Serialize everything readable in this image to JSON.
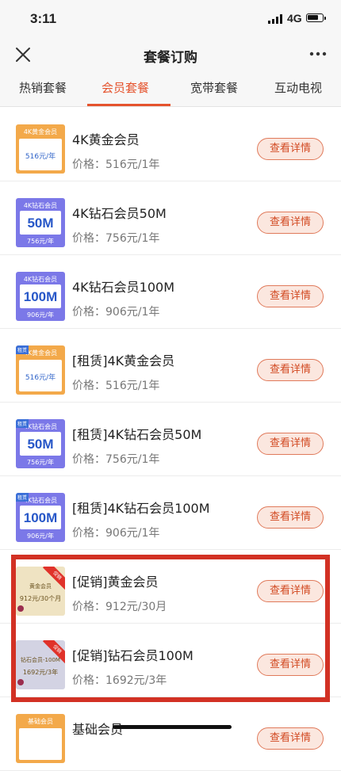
{
  "status": {
    "time": "3:11",
    "network": "4G"
  },
  "nav": {
    "title": "套餐订购"
  },
  "tabs": [
    {
      "label": "热销套餐"
    },
    {
      "label": "会员套餐"
    },
    {
      "label": "宽带套餐"
    },
    {
      "label": "互动电视"
    }
  ],
  "items": [
    {
      "title": "4K黄金会员",
      "price": "价格：516元/1年",
      "button": "查看详情",
      "thumb": {
        "caption": "4K黄金会员",
        "price": "516元/年"
      }
    },
    {
      "title": "4K钻石会员50M",
      "price": "价格：756元/1年",
      "button": "查看详情",
      "thumb": {
        "caption": "4K钻石会员",
        "big": "50M",
        "price": "756元/年"
      }
    },
    {
      "title": "4K钻石会员100M",
      "price": "价格：906元/1年",
      "button": "查看详情",
      "thumb": {
        "caption": "4K钻石会员",
        "big": "100M",
        "price": "906元/年"
      }
    },
    {
      "title": "[租赁]4K黄金会员",
      "price": "价格：516元/1年",
      "button": "查看详情",
      "thumb": {
        "tag": "租赁",
        "caption": "4K黄金会员",
        "price": "516元/年"
      }
    },
    {
      "title": "[租赁]4K钻石会员50M",
      "price": "价格：756元/1年",
      "button": "查看详情",
      "thumb": {
        "tag": "租赁",
        "caption": "4K钻石会员",
        "big": "50M",
        "price": "756元/年"
      }
    },
    {
      "title": "[租赁]4K钻石会员100M",
      "price": "价格：906元/1年",
      "button": "查看详情",
      "thumb": {
        "tag": "租赁",
        "caption": "4K钻石会员",
        "big": "100M",
        "price": "906元/年"
      }
    },
    {
      "title": "[促销]黄金会员",
      "price": "价格：912元/30月",
      "button": "查看详情",
      "thumb": {
        "ribbon": "促销",
        "caption": "黄金会员",
        "price": "912元/30个月"
      }
    },
    {
      "title": "[促销]钻石会员100M",
      "price": "价格：1692元/3年",
      "button": "查看详情",
      "thumb": {
        "ribbon": "促销",
        "caption": "钻石会员-100M",
        "price": "1692元/3年"
      }
    },
    {
      "title": "基础会员",
      "price": "",
      "button": "查看详情",
      "thumb": {
        "caption": "基础会员"
      }
    }
  ],
  "colors": {
    "accent": "#e5532d",
    "highlight": "#d23124"
  }
}
